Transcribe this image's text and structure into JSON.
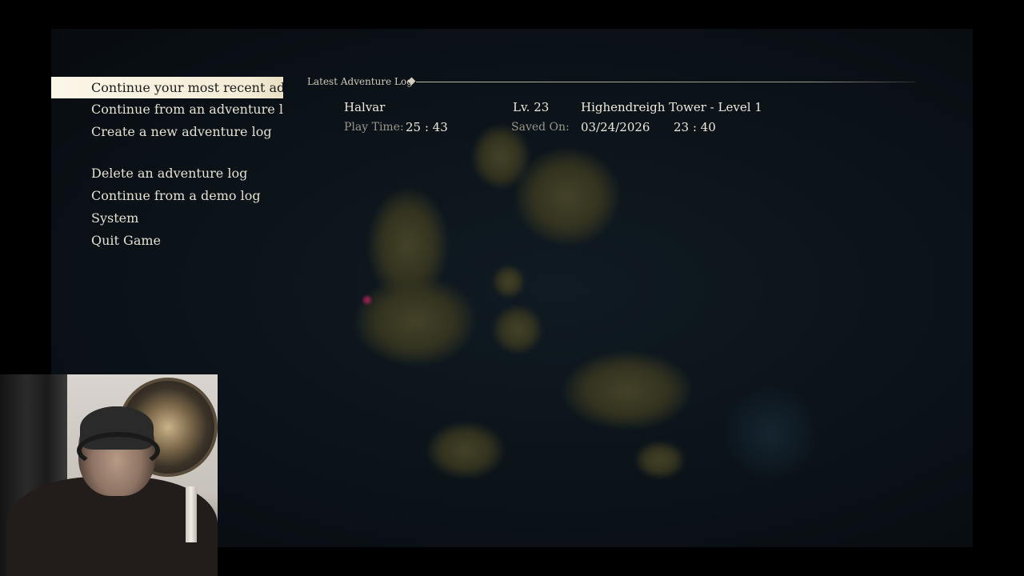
{
  "menu": {
    "items": [
      {
        "label": "Continue your most recent adventure",
        "selected": true
      },
      {
        "label": "Continue from an adventure log",
        "selected": false
      },
      {
        "label": "Create a new adventure log",
        "selected": false
      },
      {
        "label": "Delete an adventure log",
        "selected": false
      },
      {
        "label": "Continue from a demo log",
        "selected": false
      },
      {
        "label": "System",
        "selected": false
      },
      {
        "label": "Quit Game",
        "selected": false
      }
    ]
  },
  "latest_log": {
    "title": "Latest Adventure Log",
    "character_name": "Halvar",
    "level": "Lv. 23",
    "location": "Highendreigh Tower - Level 1",
    "play_time_label": "Play Time:",
    "play_time_value": "25 : 43",
    "saved_on_label": "Saved On:",
    "saved_date": "03/24/2026",
    "saved_time": "23 : 40"
  },
  "colors": {
    "background": "#000000",
    "map_water": "#0b1319",
    "menu_highlight": "#f4ecd6",
    "text_primary": "#e8e2d4",
    "text_secondary": "#9a958a"
  }
}
